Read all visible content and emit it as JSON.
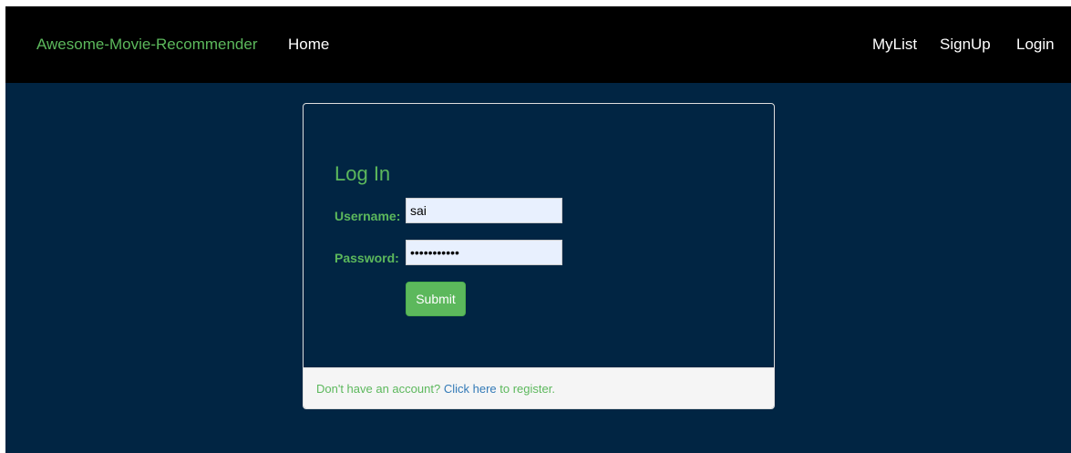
{
  "navbar": {
    "brand": "Awesome-Movie-Recommender",
    "home": "Home",
    "mylist": "MyList",
    "signup": "SignUp",
    "login": "Login"
  },
  "form": {
    "title": "Log In",
    "username_label": "Username:",
    "username_value": "sai",
    "password_label": "Password:",
    "password_value": "•••••••••••",
    "submit_label": "Submit"
  },
  "footer": {
    "prefix": "Don't have an account? ",
    "click": "Click",
    "space": " ",
    "here": "here",
    "suffix": " to register."
  },
  "colors": {
    "accent_green": "#5cb85c",
    "page_bg": "#012543",
    "navbar_bg": "#000000",
    "link_blue": "#337ab7"
  }
}
